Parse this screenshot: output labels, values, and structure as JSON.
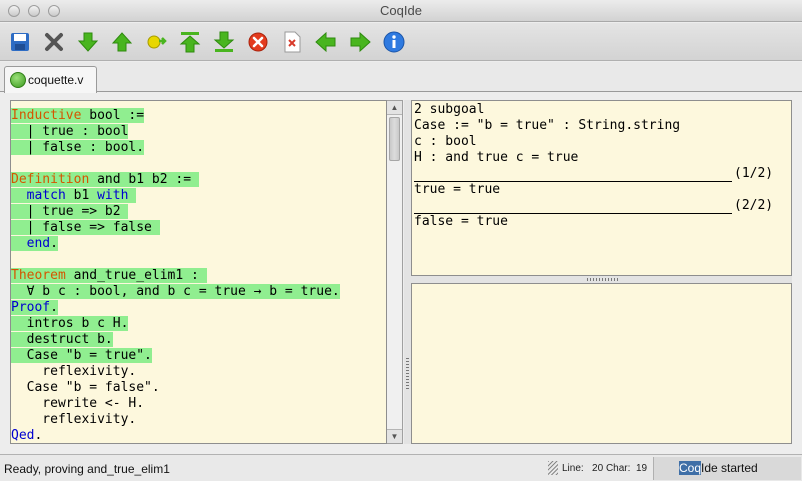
{
  "window": {
    "title": "CoqIde"
  },
  "toolbar": {
    "items": [
      {
        "name": "save-icon",
        "color": "#2d6cc4"
      },
      {
        "name": "close-x-icon",
        "color": "#555555"
      },
      {
        "name": "arrow-down-icon",
        "color": "#49b51f"
      },
      {
        "name": "arrow-up-icon",
        "color": "#49b51f"
      },
      {
        "name": "goto-cursor-icon",
        "color": "#d7c900"
      },
      {
        "name": "arrow-top-icon",
        "color": "#49b51f"
      },
      {
        "name": "arrow-bottom-icon",
        "color": "#49b51f"
      },
      {
        "name": "interrupt-icon",
        "color": "#e33b1e"
      },
      {
        "name": "document-x-icon",
        "color": "#d83a2a"
      },
      {
        "name": "arrow-left-icon",
        "color": "#49b51f"
      },
      {
        "name": "arrow-right-icon",
        "color": "#49b51f"
      },
      {
        "name": "info-icon",
        "color": "#2f7ae0"
      }
    ]
  },
  "tabs": [
    {
      "label": "coquette.v",
      "status_color": "#3a9a1d"
    }
  ],
  "script": {
    "lines": [
      {
        "parts": [
          {
            "text": "Inductive",
            "style": "orange"
          },
          {
            "text": " bool :=",
            "style": ""
          }
        ],
        "highlight": true
      },
      {
        "parts": [
          {
            "text": "  | true : bool",
            "style": ""
          }
        ],
        "highlight": true
      },
      {
        "parts": [
          {
            "text": "  | false : bool.",
            "style": ""
          }
        ],
        "highlight": true
      },
      {
        "parts": [
          {
            "text": "",
            "style": ""
          }
        ],
        "highlight": false
      },
      {
        "parts": [
          {
            "text": "Definition",
            "style": "orange"
          },
          {
            "text": " and b1 b2 := ",
            "style": ""
          }
        ],
        "highlight": true
      },
      {
        "parts": [
          {
            "text": "  ",
            "style": ""
          },
          {
            "text": "match",
            "style": "blue"
          },
          {
            "text": " b1 ",
            "style": ""
          },
          {
            "text": "with",
            "style": "blue"
          },
          {
            "text": " ",
            "style": ""
          }
        ],
        "highlight": true
      },
      {
        "parts": [
          {
            "text": "  | true => b2 ",
            "style": ""
          }
        ],
        "highlight": true
      },
      {
        "parts": [
          {
            "text": "  | false => false ",
            "style": ""
          }
        ],
        "highlight": true
      },
      {
        "parts": [
          {
            "text": "  ",
            "style": ""
          },
          {
            "text": "end",
            "style": "blue"
          },
          {
            "text": ".",
            "style": ""
          }
        ],
        "highlight": true
      },
      {
        "parts": [
          {
            "text": "",
            "style": ""
          }
        ],
        "highlight": false
      },
      {
        "parts": [
          {
            "text": "Theorem",
            "style": "orange"
          },
          {
            "text": " and_true_elim1 : ",
            "style": ""
          }
        ],
        "highlight": true
      },
      {
        "parts": [
          {
            "text": "  ∀ b c : bool, and b c = true → b = true.",
            "style": ""
          }
        ],
        "highlight": true
      },
      {
        "parts": [
          {
            "text": "Proof",
            "style": "blue"
          },
          {
            "text": ".",
            "style": ""
          }
        ],
        "highlight": true
      },
      {
        "parts": [
          {
            "text": "  intros b c H.",
            "style": ""
          }
        ],
        "highlight": true
      },
      {
        "parts": [
          {
            "text": "  destruct b.",
            "style": ""
          }
        ],
        "highlight": true
      },
      {
        "parts": [
          {
            "text": "  Case \"b = true\".",
            "style": ""
          }
        ],
        "highlight": true
      },
      {
        "parts": [
          {
            "text": "    reflexivity.",
            "style": ""
          }
        ],
        "highlight": false
      },
      {
        "parts": [
          {
            "text": "  Case \"b = false\".",
            "style": ""
          }
        ],
        "highlight": false
      },
      {
        "parts": [
          {
            "text": "    rewrite <- H.",
            "style": ""
          }
        ],
        "highlight": false
      },
      {
        "parts": [
          {
            "text": "    reflexivity.",
            "style": ""
          }
        ],
        "highlight": false
      },
      {
        "parts": [
          {
            "text": "Qed",
            "style": "blue"
          },
          {
            "text": ".",
            "style": ""
          }
        ],
        "highlight": false
      }
    ]
  },
  "goals": {
    "header": "2 subgoal",
    "hypotheses": [
      "Case := \"b = true\" : String.string",
      "c : bool",
      "H : and true c = true"
    ],
    "subgoals": [
      {
        "count": "(1/2)",
        "goal": "true = true"
      },
      {
        "count": "(2/2)",
        "goal": "false = true"
      }
    ]
  },
  "status": {
    "message": "Ready, proving and_true_elim1",
    "line_label": "Line:",
    "line_value": "20",
    "char_label": "Char:",
    "char_value": "19",
    "started_selected": "Coq",
    "started_rest": "Ide started"
  }
}
